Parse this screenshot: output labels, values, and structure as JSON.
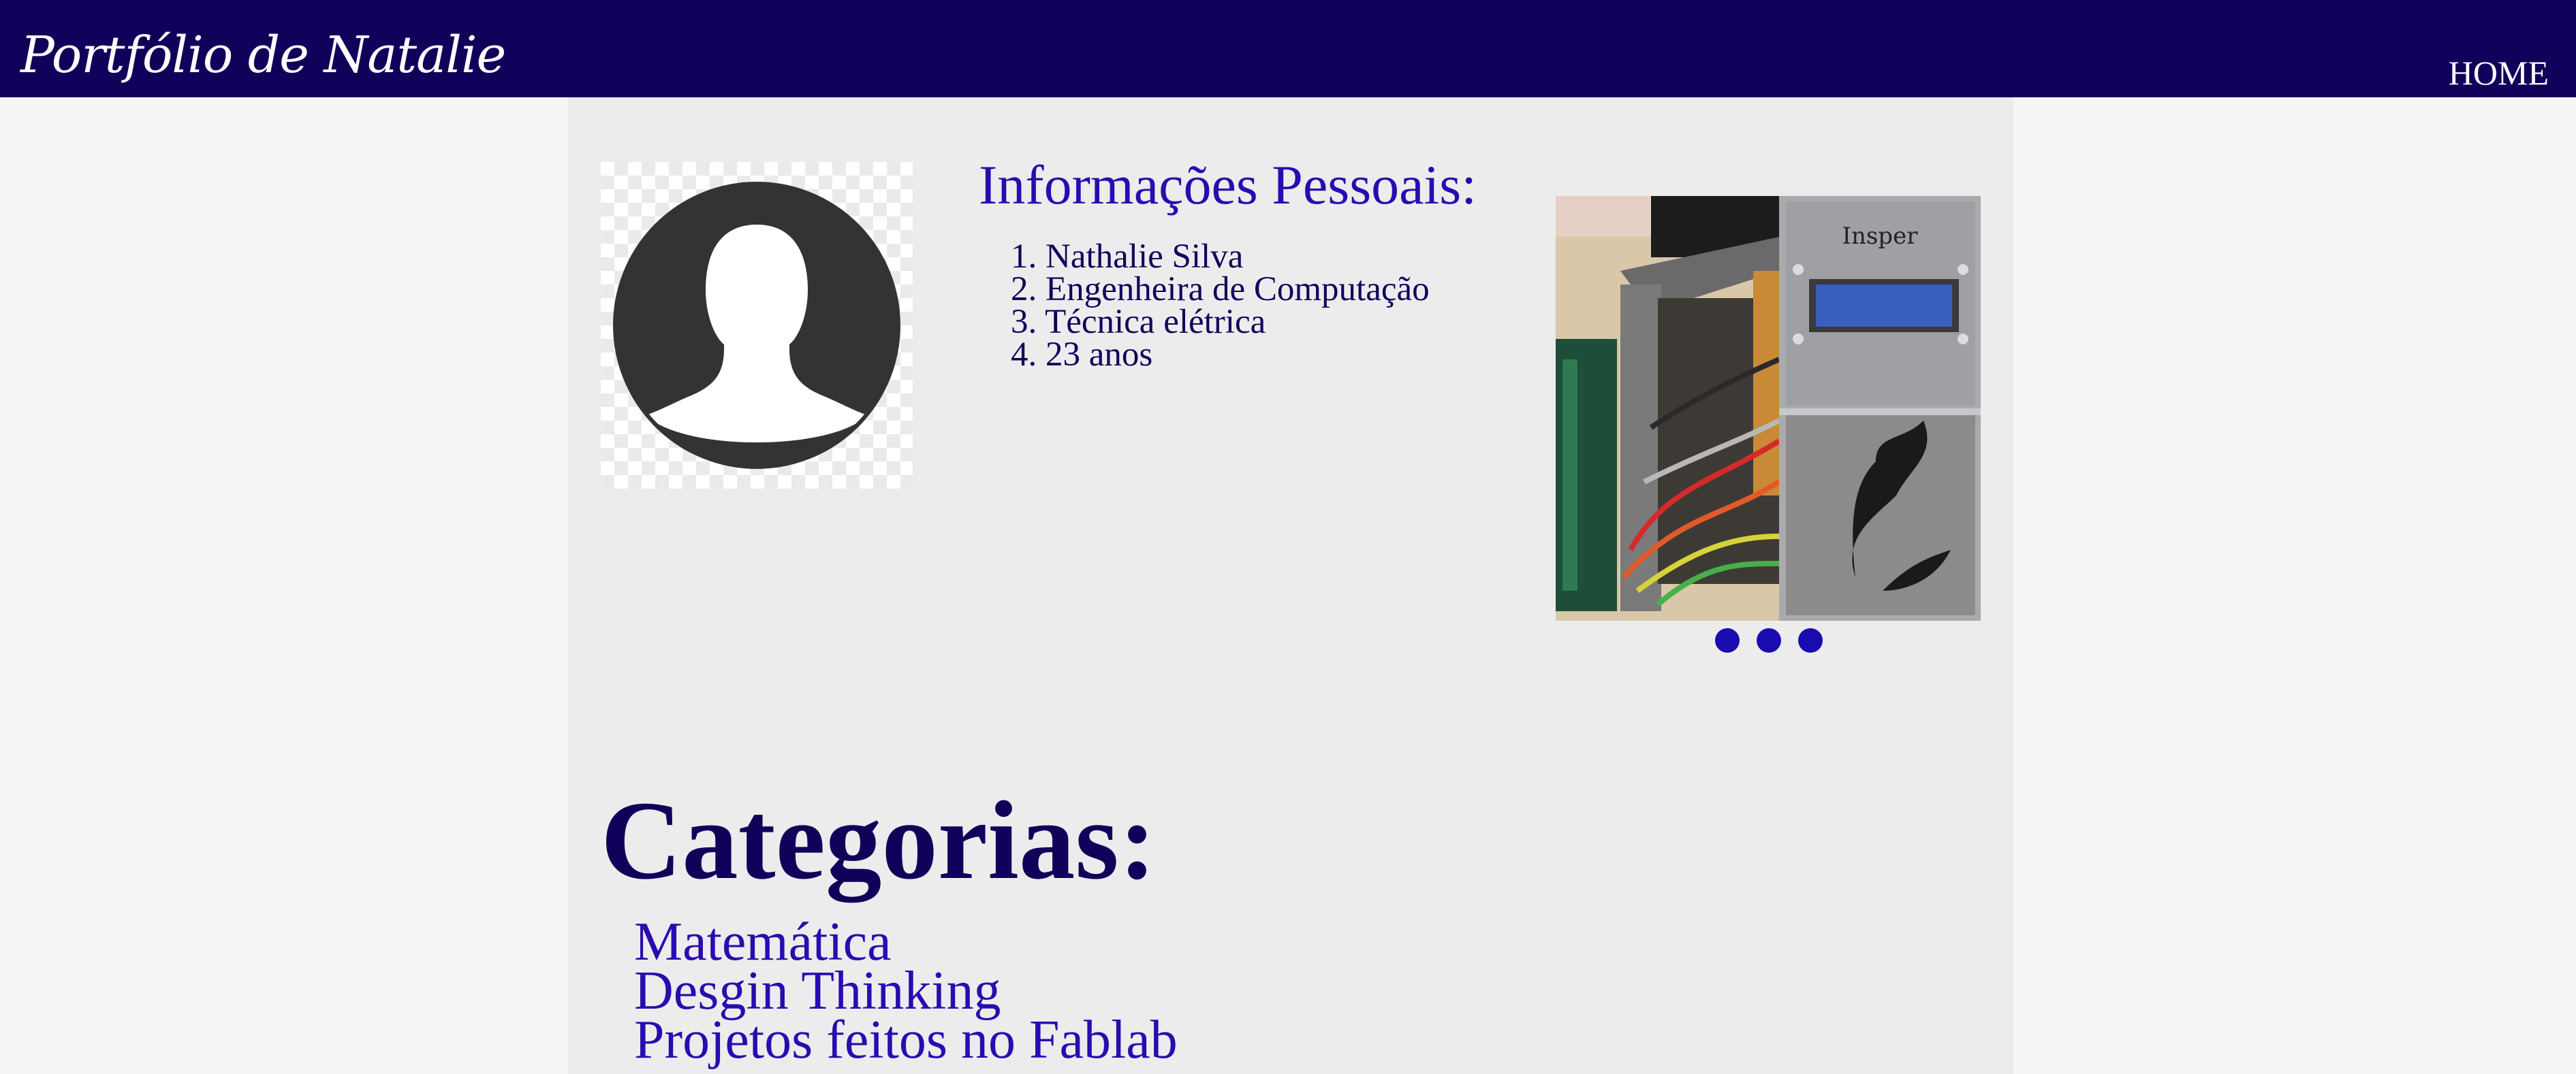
{
  "header": {
    "brand": "Portfólio de Natalie",
    "nav": [
      {
        "label": "HOME"
      }
    ]
  },
  "profile": {
    "avatar_icon": "user-silhouette-icon",
    "info_title": "Informações Pessoais:",
    "info_items": [
      "1. Nathalie Silva",
      "2. Engenheira de Computação",
      "3. Técnica elétrica",
      "4. 23 anos"
    ]
  },
  "carousel": {
    "image_text": "Insper",
    "slide_count": 3
  },
  "categories": {
    "title": "Categorias:",
    "items": [
      "Matemática",
      "Desgin Thinking",
      "Projetos feitos no Fablab"
    ]
  },
  "colors": {
    "header_bg": "#10005a",
    "accent": "#2a0bb0",
    "content_bg": "#ececec",
    "page_bg": "#f5f5f5"
  }
}
